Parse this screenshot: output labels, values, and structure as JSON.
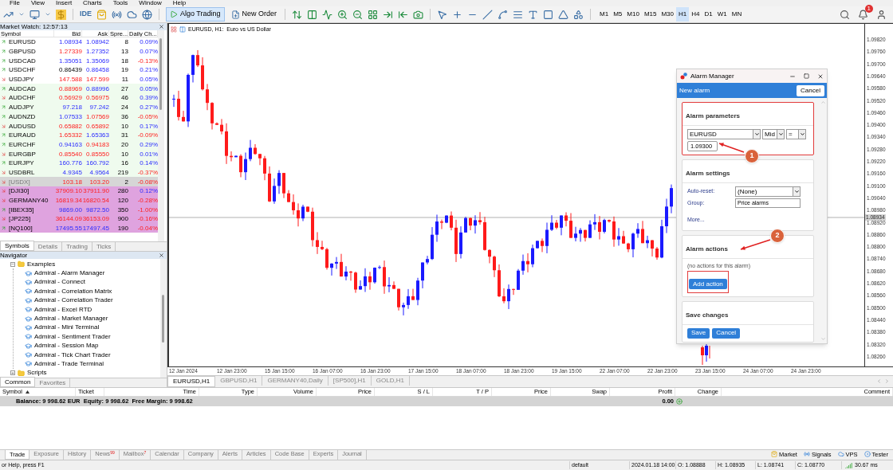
{
  "menu": [
    "File",
    "View",
    "Insert",
    "Charts",
    "Tools",
    "Window",
    "Help"
  ],
  "toolbar": {
    "ide": "IDE",
    "algo_trading": {
      "label": "Algo Trading",
      "on": true
    },
    "new_order": "New Order",
    "timeframes": [
      {
        "label": "M1",
        "selected": false
      },
      {
        "label": "M5",
        "selected": false
      },
      {
        "label": "M10",
        "selected": false
      },
      {
        "label": "M15",
        "selected": false
      },
      {
        "label": "M30",
        "selected": false
      },
      {
        "label": "H1",
        "selected": true
      },
      {
        "label": "H4",
        "selected": false
      },
      {
        "label": "D1",
        "selected": false
      },
      {
        "label": "W1",
        "selected": false
      },
      {
        "label": "MN",
        "selected": false
      }
    ],
    "notifications": "1"
  },
  "market_watch": {
    "title": "Market Watch: 12:57:13",
    "columns": [
      "Symbol",
      "Bid",
      "Ask",
      "Spre...",
      "Daily Ch..."
    ],
    "rows": [
      {
        "symbol": "EURUSD",
        "rising": true,
        "bid": "1.08934",
        "bid_up": true,
        "bid_steady": false,
        "ask": "1.08942",
        "ask_up": true,
        "spread": "8",
        "change": "0.09%",
        "change_up": true,
        "color": "#ffffff",
        "disabled": false
      },
      {
        "symbol": "GBPUSD",
        "rising": true,
        "bid": "1.27339",
        "bid_up": false,
        "bid_steady": false,
        "ask": "1.27352",
        "ask_up": true,
        "spread": "13",
        "change": "0.07%",
        "change_up": true,
        "color": "#ffffff",
        "disabled": false
      },
      {
        "symbol": "USDCAD",
        "rising": true,
        "bid": "1.35051",
        "bid_up": true,
        "bid_steady": false,
        "ask": "1.35069",
        "ask_up": true,
        "spread": "18",
        "change": "-0.13%",
        "change_up": false,
        "color": "#ffffff",
        "disabled": false
      },
      {
        "symbol": "USDCHF",
        "rising": true,
        "bid": "0.86439",
        "bid_steady": true,
        "ask": "0.86458",
        "ask_up": true,
        "spread": "19",
        "change": "0.21%",
        "change_up": true,
        "color": "#ffffff",
        "disabled": false
      },
      {
        "symbol": "USDJPY",
        "rising": false,
        "bid": "147.588",
        "bid_up": false,
        "bid_steady": false,
        "ask": "147.599",
        "ask_up": false,
        "spread": "11",
        "change": "0.05%",
        "change_up": true,
        "color": "#ffffff",
        "disabled": false
      },
      {
        "symbol": "AUDCAD",
        "rising": true,
        "bid": "0.88969",
        "bid_up": false,
        "bid_steady": false,
        "ask": "0.88996",
        "ask_up": true,
        "spread": "27",
        "change": "0.05%",
        "change_up": true,
        "color": "#effbee",
        "disabled": false
      },
      {
        "symbol": "AUDCHF",
        "rising": false,
        "bid": "0.56929",
        "bid_up": false,
        "bid_steady": false,
        "ask": "0.56975",
        "ask_up": false,
        "spread": "46",
        "change": "0.39%",
        "change_up": true,
        "color": "#effbee",
        "disabled": false
      },
      {
        "symbol": "AUDJPY",
        "rising": true,
        "bid": "97.218",
        "bid_up": true,
        "bid_steady": false,
        "ask": "97.242",
        "ask_up": true,
        "spread": "24",
        "change": "0.27%",
        "change_up": true,
        "color": "#effbee",
        "disabled": false
      },
      {
        "symbol": "AUDNZD",
        "rising": true,
        "bid": "1.07533",
        "bid_up": true,
        "bid_steady": false,
        "ask": "1.07569",
        "ask_up": false,
        "spread": "36",
        "change": "-0.05%",
        "change_up": false,
        "color": "#effbee",
        "disabled": false
      },
      {
        "symbol": "AUDUSD",
        "rising": false,
        "bid": "0.65882",
        "bid_up": false,
        "bid_steady": false,
        "ask": "0.65892",
        "ask_up": false,
        "spread": "10",
        "change": "0.17%",
        "change_up": true,
        "color": "#effbee",
        "disabled": false
      },
      {
        "symbol": "EURAUD",
        "rising": true,
        "bid": "1.65332",
        "bid_up": false,
        "bid_steady": false,
        "ask": "1.65363",
        "ask_up": true,
        "spread": "31",
        "change": "-0.09%",
        "change_up": false,
        "color": "#effbee",
        "disabled": false
      },
      {
        "symbol": "EURCHF",
        "rising": true,
        "bid": "0.94163",
        "bid_up": true,
        "bid_steady": false,
        "ask": "0.94183",
        "ask_up": false,
        "spread": "20",
        "change": "0.29%",
        "change_up": true,
        "color": "#effbee",
        "disabled": false
      },
      {
        "symbol": "EURGBP",
        "rising": false,
        "bid": "0.85540",
        "bid_up": false,
        "bid_steady": false,
        "ask": "0.85550",
        "ask_up": false,
        "spread": "10",
        "change": "0.01%",
        "change_up": true,
        "color": "#effbee",
        "disabled": false
      },
      {
        "symbol": "EURJPY",
        "rising": true,
        "bid": "160.776",
        "bid_up": true,
        "bid_steady": false,
        "ask": "160.792",
        "ask_up": true,
        "spread": "16",
        "change": "0.14%",
        "change_up": true,
        "color": "#effbee",
        "disabled": false
      },
      {
        "symbol": "USDBRL",
        "rising": false,
        "bid": "4.9345",
        "bid_up": true,
        "bid_steady": false,
        "ask": "4.9564",
        "ask_up": true,
        "spread": "219",
        "change": "-0.37%",
        "change_up": false,
        "color": "#effbee",
        "disabled": false
      },
      {
        "symbol": "[USDX]",
        "rising": false,
        "bid": "103.18",
        "bid_up": false,
        "bid_steady": false,
        "ask": "103.20",
        "ask_up": false,
        "spread": "2",
        "change": "-0.08%",
        "change_up": false,
        "color": "#d6d6d6",
        "disabled": true
      },
      {
        "symbol": "[DJI30]",
        "rising": false,
        "bid": "37909.10",
        "bid_up": false,
        "bid_steady": false,
        "ask": "37911.90",
        "ask_up": false,
        "spread": "280",
        "change": "0.12%",
        "change_up": true,
        "color": "#dfa3df",
        "disabled": false
      },
      {
        "symbol": "GERMANY40",
        "rising": false,
        "bid": "16819.34",
        "bid_up": false,
        "bid_steady": false,
        "ask": "16820.54",
        "ask_up": false,
        "spread": "120",
        "change": "-0.28%",
        "change_up": false,
        "color": "#dfa3df",
        "disabled": false
      },
      {
        "symbol": "[IBEX35]",
        "rising": true,
        "bid": "9869.00",
        "bid_up": true,
        "bid_steady": false,
        "ask": "9872.50",
        "ask_up": true,
        "spread": "350",
        "change": "-1.00%",
        "change_up": false,
        "color": "#dfa3df",
        "disabled": false
      },
      {
        "symbol": "[JP225]",
        "rising": false,
        "bid": "36144.09",
        "bid_up": false,
        "bid_steady": false,
        "ask": "36153.09",
        "ask_up": false,
        "spread": "900",
        "change": "-0.16%",
        "change_up": false,
        "color": "#dfa3df",
        "disabled": false
      },
      {
        "symbol": "[NQ100]",
        "rising": true,
        "bid": "17495.55",
        "bid_up": true,
        "bid_steady": false,
        "ask": "17497.45",
        "ask_up": true,
        "spread": "190",
        "change": "-0.04%",
        "change_up": false,
        "color": "#dfa3df",
        "disabled": false
      }
    ],
    "tabs": [
      {
        "label": "Symbols",
        "selected": true
      },
      {
        "label": "Details",
        "selected": false
      },
      {
        "label": "Trading",
        "selected": false
      },
      {
        "label": "Ticks",
        "selected": false
      }
    ]
  },
  "navigator": {
    "title": "Navigator",
    "tree": [
      {
        "label": "Examples",
        "kind": "folder",
        "expanded": true,
        "children": [
          {
            "label": "Admiral - Alarm Manager",
            "kind": "program"
          },
          {
            "label": "Admiral - Connect",
            "kind": "program"
          },
          {
            "label": "Admiral - Correlation Matrix",
            "kind": "program"
          },
          {
            "label": "Admiral - Correlation Trader",
            "kind": "program"
          },
          {
            "label": "Admiral - Excel RTD",
            "kind": "program"
          },
          {
            "label": "Admiral - Market Manager",
            "kind": "program"
          },
          {
            "label": "Admiral - Mini Terminal",
            "kind": "program"
          },
          {
            "label": "Admiral - Sentiment Trader",
            "kind": "program"
          },
          {
            "label": "Admiral - Session Map",
            "kind": "program"
          },
          {
            "label": "Admiral - Tick Chart Trader",
            "kind": "program"
          },
          {
            "label": "Admiral - Trade Terminal",
            "kind": "program"
          }
        ]
      },
      {
        "label": "Scripts",
        "kind": "folder",
        "expanded": false
      }
    ],
    "tabs": [
      {
        "label": "Common",
        "selected": true
      },
      {
        "label": "Favorites",
        "selected": false
      }
    ]
  },
  "chart": {
    "title": "EURUSD, H1:  Euro vs US Dollar",
    "price_labels": [
      "1.09820",
      "1.09760",
      "1.09700",
      "1.09640",
      "1.09580",
      "1.09520",
      "1.09460",
      "1.09400",
      "1.09340",
      "1.09280",
      "1.09220",
      "1.09160",
      "1.09100",
      "1.09040",
      "1.08980",
      "1.08920",
      "1.08860",
      "1.08800",
      "1.08740",
      "1.08680",
      "1.08620",
      "1.08560",
      "1.08500",
      "1.08440",
      "1.08380",
      "1.08320",
      "1.08260"
    ],
    "current_price": "1.08934",
    "time_labels": [
      "12 Jan 2024",
      "12 Jan 23:00",
      "15 Jan 15:00",
      "16 Jan 07:00",
      "16 Jan 23:00",
      "17 Jan 15:00",
      "18 Jan 07:00",
      "18 Jan 23:00",
      "19 Jan 15:00",
      "22 Jan 07:00",
      "22 Jan 23:00",
      "23 Jan 15:00",
      "24 Jan 07:00",
      "24 Jan 23:00"
    ],
    "tabs": [
      {
        "label": "EURUSD,H1",
        "selected": true
      },
      {
        "label": "GBPUSD,H1",
        "selected": false
      },
      {
        "label": "GERMANY40,Daily",
        "selected": false
      },
      {
        "label": "[SP500],H1",
        "selected": false
      },
      {
        "label": "GOLD,H1",
        "selected": false
      }
    ]
  },
  "alarm_manager": {
    "title": "Alarm Manager",
    "header": "New alarm",
    "header_button": "Cancel",
    "parameters": {
      "title": "Alarm parameters",
      "highlighted": true,
      "symbol": "EURUSD",
      "price_type": "Mid",
      "operator": "=",
      "value": "1.09300"
    },
    "settings": {
      "title": "Alarm settings",
      "auto_reset_label": "Auto-reset:",
      "auto_reset": "(None)",
      "group_label": "Group:",
      "group": "Price alarms",
      "more": "More..."
    },
    "actions": {
      "title": "Alarm actions",
      "empty_text": "(no actions for this alarm)",
      "button": "Add action",
      "highlighted": true
    },
    "save": {
      "title": "Save changes",
      "buttons": [
        "Save",
        "Cancel"
      ]
    },
    "callouts": [
      "1",
      "2"
    ]
  },
  "toolbox": {
    "columns": [
      {
        "label": "Symbol",
        "sorted": true
      },
      {
        "label": "Ticket",
        "sorted": false
      },
      {
        "label": "Time",
        "sorted": false
      },
      {
        "label": "Type",
        "sorted": false
      },
      {
        "label": "Volume",
        "sorted": false
      },
      {
        "label": "Price",
        "sorted": false
      },
      {
        "label": "S / L",
        "sorted": false
      },
      {
        "label": "T / P",
        "sorted": false
      },
      {
        "label": "Price",
        "sorted": false
      },
      {
        "label": "Swap",
        "sorted": false
      },
      {
        "label": "Profit",
        "sorted": false
      },
      {
        "label": "Change",
        "sorted": false
      },
      {
        "label": "Comment",
        "sorted": false
      }
    ],
    "balance": "Balance: 9 998.62 EUR  Equity: 9 998.62  Free Margin: 9 998.62",
    "profit": "0.00",
    "tabs": [
      {
        "label": "Trade",
        "selected": true
      },
      {
        "label": "Exposure",
        "selected": false
      },
      {
        "label": "History",
        "selected": false
      },
      {
        "label": "News",
        "badge": "99",
        "selected": false
      },
      {
        "label": "Mailbox",
        "badge": "7",
        "selected": false
      },
      {
        "label": "Calendar",
        "selected": false
      },
      {
        "label": "Company",
        "selected": false
      },
      {
        "label": "Alerts",
        "selected": false
      },
      {
        "label": "Articles",
        "selected": false
      },
      {
        "label": "Code Base",
        "selected": false
      },
      {
        "label": "Experts",
        "selected": false
      },
      {
        "label": "Journal",
        "selected": false
      }
    ],
    "services": [
      {
        "label": "Market",
        "kind": "market"
      },
      {
        "label": "Signals",
        "kind": "signals"
      },
      {
        "label": "VPS",
        "kind": "vps"
      },
      {
        "label": "Tester",
        "kind": "tester"
      }
    ]
  },
  "status_bar": {
    "help": "or Help, press F1",
    "profile": "default",
    "time": "2024.01.18 14:00",
    "open": "O: 1.08888",
    "high": "H: 1.08935",
    "low": "L: 1.08741",
    "close": "C: 1.08770",
    "ping": "30.67 ms"
  }
}
